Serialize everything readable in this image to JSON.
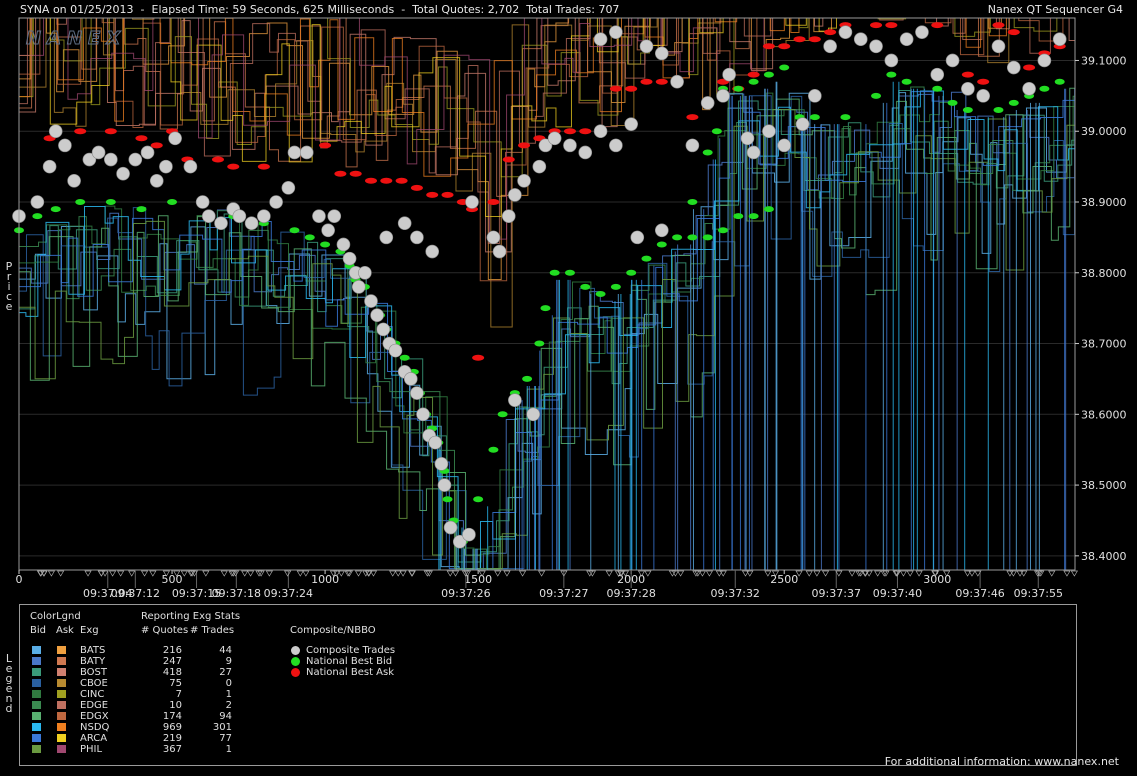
{
  "header": {
    "left": "SYNA on 01/25/2013  -  Elapsed Time: 59 Seconds, 625 Milliseconds  -  Total Quotes: 2,702  Total Trades: 707",
    "right": "Nanex QT Sequencer G4"
  },
  "watermark": "NANEX",
  "ylabel": "Price",
  "legend_title_vertical": "Legend",
  "footer": "For additional information: www.nanex.net",
  "colors": {
    "nbb": "#22dd22",
    "nbo": "#ee1111",
    "trade": "#cccccc",
    "bg": "#000000"
  },
  "legend": {
    "colorlgnd_title": "ColorLgnd",
    "stats_title": "Reporting Exg Stats",
    "col_bid": "Bid",
    "col_ask": "Ask",
    "col_exg": "Exg",
    "col_quotes": "# Quotes",
    "col_trades": "# Trades",
    "composite_title": "Composite/NBBO",
    "composite_items": [
      {
        "label": "Composite Trades",
        "color": "#cccccc"
      },
      {
        "label": "National Best Bid",
        "color": "#22dd22"
      },
      {
        "label": "National Best Ask",
        "color": "#ee1111"
      }
    ],
    "exchanges": [
      {
        "name": "BATS",
        "quotes": "216",
        "trades": "44",
        "bid_color": "#5aaee6",
        "ask_color": "#f0a040"
      },
      {
        "name": "BATY",
        "quotes": "247",
        "trades": "9",
        "bid_color": "#4a78c8",
        "ask_color": "#d07850"
      },
      {
        "name": "BOST",
        "quotes": "418",
        "trades": "27",
        "bid_color": "#3a9a7a",
        "ask_color": "#d08070"
      },
      {
        "name": "CBOE",
        "quotes": "75",
        "trades": "0",
        "bid_color": "#2a60a0",
        "ask_color": "#b88a30"
      },
      {
        "name": "CINC",
        "quotes": "7",
        "trades": "1",
        "bid_color": "#307a40",
        "ask_color": "#a0a020"
      },
      {
        "name": "EDGE",
        "quotes": "10",
        "trades": "2",
        "bid_color": "#3a8a50",
        "ask_color": "#c07060"
      },
      {
        "name": "EDGX",
        "quotes": "174",
        "trades": "94",
        "bid_color": "#58b070",
        "ask_color": "#c06840"
      },
      {
        "name": "NSDQ",
        "quotes": "969",
        "trades": "301",
        "bid_color": "#2ab8f0",
        "ask_color": "#f08020"
      },
      {
        "name": "ARCA",
        "quotes": "219",
        "trades": "77",
        "bid_color": "#3a78d8",
        "ask_color": "#f0d020"
      },
      {
        "name": "PHIL",
        "quotes": "367",
        "trades": "1",
        "bid_color": "#6a9a40",
        "ask_color": "#a04870"
      }
    ]
  },
  "chart_data": {
    "type": "scatter",
    "ylabel": "Price",
    "ylim": [
      38.38,
      39.16
    ],
    "xlim": [
      0,
      3450
    ],
    "y_ticks": [
      "38.4000",
      "38.5000",
      "38.6000",
      "38.7000",
      "38.8000",
      "38.9000",
      "39.0000",
      "39.1000"
    ],
    "y_tick_values": [
      38.4,
      38.5,
      38.6,
      38.7,
      38.8,
      38.9,
      39.0,
      39.1
    ],
    "x_ticks": [
      {
        "value": 0,
        "label": "0"
      },
      {
        "value": 500,
        "label": "500"
      },
      {
        "value": 1000,
        "label": "1000"
      },
      {
        "value": 1500,
        "label": "1500"
      },
      {
        "value": 2000,
        "label": "2000"
      },
      {
        "value": 2500,
        "label": "2500"
      },
      {
        "value": 3000,
        "label": "3000"
      }
    ],
    "time_labels": [
      {
        "value": 290,
        "label": "09:37:04"
      },
      {
        "value": 380,
        "label": "09:37:12"
      },
      {
        "value": 580,
        "label": "09:37:15"
      },
      {
        "value": 710,
        "label": "09:37:18"
      },
      {
        "value": 880,
        "label": "09:37:24"
      },
      {
        "value": 1460,
        "label": "09:37:26"
      },
      {
        "value": 1780,
        "label": "09:37:27"
      },
      {
        "value": 2000,
        "label": "09:37:28"
      },
      {
        "value": 2340,
        "label": "09:37:32"
      },
      {
        "value": 2670,
        "label": "09:37:37"
      },
      {
        "value": 2870,
        "label": "09:37:40"
      },
      {
        "value": 3140,
        "label": "09:37:46"
      },
      {
        "value": 3330,
        "label": "09:37:55"
      }
    ],
    "series": [
      {
        "name": "Composite Trades",
        "color": "#cccccc",
        "points": [
          [
            0,
            38.88
          ],
          [
            60,
            38.9
          ],
          [
            100,
            38.95
          ],
          [
            120,
            39.0
          ],
          [
            150,
            38.98
          ],
          [
            180,
            38.93
          ],
          [
            230,
            38.96
          ],
          [
            260,
            38.97
          ],
          [
            300,
            38.96
          ],
          [
            340,
            38.94
          ],
          [
            380,
            38.96
          ],
          [
            420,
            38.97
          ],
          [
            450,
            38.93
          ],
          [
            480,
            38.95
          ],
          [
            510,
            38.99
          ],
          [
            560,
            38.95
          ],
          [
            600,
            38.9
          ],
          [
            620,
            38.88
          ],
          [
            660,
            38.87
          ],
          [
            700,
            38.89
          ],
          [
            720,
            38.88
          ],
          [
            760,
            38.87
          ],
          [
            800,
            38.88
          ],
          [
            840,
            38.9
          ],
          [
            880,
            38.92
          ],
          [
            900,
            38.97
          ],
          [
            940,
            38.97
          ],
          [
            980,
            38.88
          ],
          [
            1010,
            38.86
          ],
          [
            1030,
            38.88
          ],
          [
            1060,
            38.84
          ],
          [
            1080,
            38.82
          ],
          [
            1100,
            38.8
          ],
          [
            1110,
            38.78
          ],
          [
            1130,
            38.8
          ],
          [
            1150,
            38.76
          ],
          [
            1170,
            38.74
          ],
          [
            1190,
            38.72
          ],
          [
            1210,
            38.7
          ],
          [
            1230,
            38.69
          ],
          [
            1260,
            38.66
          ],
          [
            1280,
            38.65
          ],
          [
            1300,
            38.63
          ],
          [
            1320,
            38.6
          ],
          [
            1340,
            38.57
          ],
          [
            1360,
            38.56
          ],
          [
            1380,
            38.53
          ],
          [
            1390,
            38.5
          ],
          [
            1410,
            38.44
          ],
          [
            1440,
            38.42
          ],
          [
            1470,
            38.43
          ],
          [
            1200,
            38.85
          ],
          [
            1260,
            38.87
          ],
          [
            1300,
            38.85
          ],
          [
            1350,
            38.83
          ],
          [
            1480,
            38.9
          ],
          [
            1550,
            38.85
          ],
          [
            1570,
            38.83
          ],
          [
            1600,
            38.88
          ],
          [
            1620,
            38.91
          ],
          [
            1650,
            38.93
          ],
          [
            1700,
            38.95
          ],
          [
            1720,
            38.98
          ],
          [
            1750,
            38.99
          ],
          [
            1800,
            38.98
          ],
          [
            1850,
            38.97
          ],
          [
            1900,
            39.0
          ],
          [
            1950,
            38.98
          ],
          [
            2000,
            39.01
          ],
          [
            1620,
            38.62
          ],
          [
            1680,
            38.6
          ],
          [
            2020,
            38.85
          ],
          [
            2100,
            38.86
          ],
          [
            2200,
            38.98
          ],
          [
            2250,
            39.04
          ],
          [
            2300,
            39.05
          ],
          [
            2320,
            39.08
          ],
          [
            2380,
            38.99
          ],
          [
            2400,
            38.97
          ],
          [
            2450,
            39.0
          ],
          [
            2500,
            38.98
          ],
          [
            2560,
            39.01
          ],
          [
            2600,
            39.05
          ],
          [
            2650,
            39.12
          ],
          [
            2700,
            39.14
          ],
          [
            2750,
            39.13
          ],
          [
            2800,
            39.12
          ],
          [
            2850,
            39.1
          ],
          [
            2900,
            39.13
          ],
          [
            2950,
            39.14
          ],
          [
            3000,
            39.08
          ],
          [
            3050,
            39.1
          ],
          [
            3100,
            39.06
          ],
          [
            3150,
            39.05
          ],
          [
            3200,
            39.12
          ],
          [
            3250,
            39.09
          ],
          [
            3300,
            39.06
          ],
          [
            3350,
            39.1
          ],
          [
            3400,
            39.13
          ],
          [
            1900,
            39.13
          ],
          [
            1950,
            39.14
          ],
          [
            2050,
            39.12
          ],
          [
            2100,
            39.11
          ],
          [
            2150,
            39.07
          ]
        ]
      },
      {
        "name": "National Best Bid",
        "color": "#22dd22",
        "points": [
          [
            0,
            38.86
          ],
          [
            60,
            38.88
          ],
          [
            120,
            38.89
          ],
          [
            200,
            38.9
          ],
          [
            300,
            38.9
          ],
          [
            400,
            38.89
          ],
          [
            500,
            38.9
          ],
          [
            600,
            38.9
          ],
          [
            700,
            38.88
          ],
          [
            800,
            38.87
          ],
          [
            900,
            38.86
          ],
          [
            950,
            38.85
          ],
          [
            1000,
            38.84
          ],
          [
            1050,
            38.83
          ],
          [
            1080,
            38.81
          ],
          [
            1100,
            38.79
          ],
          [
            1130,
            38.78
          ],
          [
            1150,
            38.76
          ],
          [
            1180,
            38.74
          ],
          [
            1200,
            38.72
          ],
          [
            1230,
            38.7
          ],
          [
            1260,
            38.68
          ],
          [
            1290,
            38.66
          ],
          [
            1310,
            38.63
          ],
          [
            1330,
            38.6
          ],
          [
            1350,
            38.58
          ],
          [
            1370,
            38.56
          ],
          [
            1390,
            38.52
          ],
          [
            1400,
            38.48
          ],
          [
            1420,
            38.45
          ],
          [
            1450,
            38.42
          ],
          [
            1500,
            38.48
          ],
          [
            1550,
            38.55
          ],
          [
            1580,
            38.6
          ],
          [
            1620,
            38.63
          ],
          [
            1660,
            38.65
          ],
          [
            1700,
            38.7
          ],
          [
            1720,
            38.75
          ],
          [
            1750,
            38.8
          ],
          [
            1800,
            38.8
          ],
          [
            1850,
            38.78
          ],
          [
            1900,
            38.77
          ],
          [
            1950,
            38.78
          ],
          [
            2000,
            38.8
          ],
          [
            2050,
            38.82
          ],
          [
            2100,
            38.84
          ],
          [
            2150,
            38.85
          ],
          [
            2200,
            38.85
          ],
          [
            2250,
            38.85
          ],
          [
            2300,
            38.86
          ],
          [
            2350,
            38.88
          ],
          [
            2400,
            38.88
          ],
          [
            2450,
            38.89
          ],
          [
            2200,
            38.9
          ],
          [
            2250,
            38.97
          ],
          [
            2280,
            39.0
          ],
          [
            2300,
            39.06
          ],
          [
            2350,
            39.06
          ],
          [
            2400,
            39.07
          ],
          [
            2450,
            39.08
          ],
          [
            2500,
            39.09
          ],
          [
            2550,
            39.02
          ],
          [
            2600,
            39.02
          ],
          [
            2700,
            39.02
          ],
          [
            2800,
            39.05
          ],
          [
            2850,
            39.08
          ],
          [
            2900,
            39.07
          ],
          [
            3000,
            39.06
          ],
          [
            3050,
            39.04
          ],
          [
            3100,
            39.03
          ],
          [
            3200,
            39.03
          ],
          [
            3250,
            39.04
          ],
          [
            3300,
            39.05
          ],
          [
            3350,
            39.06
          ],
          [
            3400,
            39.07
          ]
        ]
      },
      {
        "name": "National Best Ask",
        "color": "#ee1111",
        "points": [
          [
            100,
            38.99
          ],
          [
            200,
            39.0
          ],
          [
            300,
            39.0
          ],
          [
            400,
            38.99
          ],
          [
            450,
            38.98
          ],
          [
            500,
            39.0
          ],
          [
            550,
            38.96
          ],
          [
            650,
            38.96
          ],
          [
            700,
            38.95
          ],
          [
            800,
            38.95
          ],
          [
            900,
            38.97
          ],
          [
            1000,
            38.98
          ],
          [
            1050,
            38.94
          ],
          [
            1100,
            38.94
          ],
          [
            1150,
            38.93
          ],
          [
            1200,
            38.93
          ],
          [
            1250,
            38.93
          ],
          [
            1300,
            38.92
          ],
          [
            1350,
            38.91
          ],
          [
            1400,
            38.91
          ],
          [
            1450,
            38.9
          ],
          [
            1480,
            38.89
          ],
          [
            1500,
            38.68
          ],
          [
            1550,
            38.9
          ],
          [
            1600,
            38.96
          ],
          [
            1650,
            38.98
          ],
          [
            1700,
            38.99
          ],
          [
            1750,
            39.0
          ],
          [
            1800,
            39.0
          ],
          [
            1850,
            39.0
          ],
          [
            1900,
            39.0
          ],
          [
            1950,
            39.06
          ],
          [
            2000,
            39.06
          ],
          [
            2050,
            39.07
          ],
          [
            2100,
            39.07
          ],
          [
            2150,
            39.07
          ],
          [
            2200,
            39.02
          ],
          [
            2250,
            39.04
          ],
          [
            2300,
            39.07
          ],
          [
            2350,
            39.06
          ],
          [
            2400,
            39.08
          ],
          [
            2450,
            39.12
          ],
          [
            2500,
            39.12
          ],
          [
            2550,
            39.13
          ],
          [
            2600,
            39.13
          ],
          [
            2650,
            39.14
          ],
          [
            2700,
            39.15
          ],
          [
            2750,
            39.13
          ],
          [
            2800,
            39.15
          ],
          [
            2850,
            39.15
          ],
          [
            2900,
            39.13
          ],
          [
            2950,
            39.14
          ],
          [
            3000,
            39.15
          ],
          [
            3050,
            39.1
          ],
          [
            3100,
            39.08
          ],
          [
            3150,
            39.07
          ],
          [
            3200,
            39.15
          ],
          [
            3250,
            39.14
          ],
          [
            3300,
            39.09
          ],
          [
            3350,
            39.11
          ],
          [
            3400,
            39.12
          ]
        ]
      }
    ]
  }
}
